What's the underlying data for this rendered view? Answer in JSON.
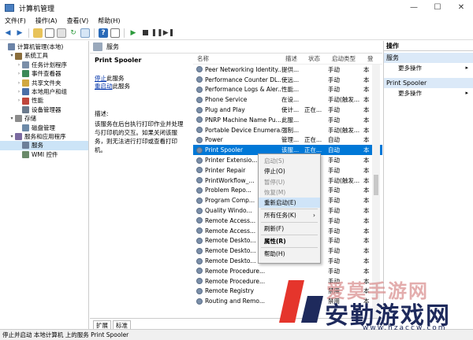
{
  "window": {
    "title": "计算机管理",
    "min": "—",
    "max": "☐",
    "close": "✕"
  },
  "menu": [
    "文件(F)",
    "操作(A)",
    "查看(V)",
    "帮助(H)"
  ],
  "tree": [
    {
      "label": "计算机管理(本地)",
      "level": 0,
      "arrow": ""
    },
    {
      "label": "系统工具",
      "level": 1,
      "arrow": "▾"
    },
    {
      "label": "任务计划程序",
      "level": 2,
      "arrow": "›"
    },
    {
      "label": "事件查看器",
      "level": 2,
      "arrow": "›"
    },
    {
      "label": "共享文件夹",
      "level": 2,
      "arrow": "›"
    },
    {
      "label": "本地用户和组",
      "level": 2,
      "arrow": "›"
    },
    {
      "label": "性能",
      "level": 2,
      "arrow": "›"
    },
    {
      "label": "设备管理器",
      "level": 2,
      "arrow": ""
    },
    {
      "label": "存储",
      "level": 1,
      "arrow": "▾"
    },
    {
      "label": "磁盘管理",
      "level": 2,
      "arrow": ""
    },
    {
      "label": "服务和应用程序",
      "level": 1,
      "arrow": "▾"
    },
    {
      "label": "服务",
      "level": 2,
      "arrow": "",
      "selected": true
    },
    {
      "label": "WMI 控件",
      "level": 2,
      "arrow": ""
    }
  ],
  "center": {
    "header": "服务",
    "service_name": "Print Spooler",
    "stop_link": "停止",
    "stop_suffix": "此服务",
    "restart_link": "重启动",
    "restart_suffix": "此服务",
    "desc_label": "描述:",
    "desc_text": "该服务在后台执行打印作业并处理与打印机的交互。如果关闭该服务，则无法进行打印或查看打印机。"
  },
  "columns": {
    "name": "名称",
    "desc": "描述",
    "status": "状态",
    "startup": "启动类型",
    "logon": "登"
  },
  "services": [
    {
      "name": "Peer Networking Identity...",
      "desc": "提供...",
      "status": "",
      "startup": "手动",
      "logon": "本"
    },
    {
      "name": "Performance Counter DL...",
      "desc": "使远...",
      "status": "",
      "startup": "手动",
      "logon": "本"
    },
    {
      "name": "Performance Logs & Aler...",
      "desc": "性能...",
      "status": "",
      "startup": "手动",
      "logon": "本"
    },
    {
      "name": "Phone Service",
      "desc": "在设...",
      "status": "",
      "startup": "手动(触发...",
      "logon": "本"
    },
    {
      "name": "Plug and Play",
      "desc": "使计...",
      "status": "正在...",
      "startup": "手动",
      "logon": "本"
    },
    {
      "name": "PNRP Machine Name Pu...",
      "desc": "此服...",
      "status": "",
      "startup": "手动",
      "logon": "本"
    },
    {
      "name": "Portable Device Enumera...",
      "desc": "强制...",
      "status": "",
      "startup": "手动(触发...",
      "logon": "本"
    },
    {
      "name": "Power",
      "desc": "管理...",
      "status": "正在...",
      "startup": "自动",
      "logon": "本"
    },
    {
      "name": "Print Spooler",
      "desc": "该服...",
      "status": "正在...",
      "startup": "自动",
      "logon": "本",
      "selected": true
    },
    {
      "name": "Printer Extensio...",
      "desc": "",
      "status": "",
      "startup": "手动",
      "logon": "本"
    },
    {
      "name": "Printer Repair",
      "desc": "",
      "status": "",
      "startup": "手动",
      "logon": "本"
    },
    {
      "name": "PrintWorkflow_...",
      "desc": "",
      "status": "",
      "startup": "手动(触发...",
      "logon": "本"
    },
    {
      "name": "Problem Repo...",
      "desc": "",
      "status": "",
      "startup": "手动",
      "logon": "本"
    },
    {
      "name": "Program Comp...",
      "desc": "",
      "status": "",
      "startup": "手动",
      "logon": "本"
    },
    {
      "name": "Quality Windo...",
      "desc": "",
      "status": "",
      "startup": "手动",
      "logon": "本"
    },
    {
      "name": "Remote Access...",
      "desc": "",
      "status": "",
      "startup": "手动",
      "logon": "本"
    },
    {
      "name": "Remote Access...",
      "desc": "",
      "status": "",
      "startup": "手动",
      "logon": "本"
    },
    {
      "name": "Remote Deskto...",
      "desc": "",
      "status": "",
      "startup": "手动",
      "logon": "本"
    },
    {
      "name": "Remote Deskto...",
      "desc": "",
      "status": "",
      "startup": "手动",
      "logon": "本"
    },
    {
      "name": "Remote Deskto...",
      "desc": "",
      "status": "",
      "startup": "手动",
      "logon": "本"
    },
    {
      "name": "Remote Procedure...",
      "desc": "",
      "status": "",
      "startup": "手动",
      "logon": "本"
    },
    {
      "name": "Remote Procedure...",
      "desc": "",
      "status": "",
      "startup": "手动",
      "logon": "本"
    },
    {
      "name": "Remote Registry",
      "desc": "",
      "status": "",
      "startup": "禁用",
      "logon": "本"
    },
    {
      "name": "Routing and Remo...",
      "desc": "",
      "status": "",
      "startup": "禁用",
      "logon": "本"
    }
  ],
  "context_menu": [
    {
      "label": "启动(S)",
      "state": "disabled"
    },
    {
      "label": "停止(O)",
      "state": ""
    },
    {
      "label": "暂停(U)",
      "state": "disabled"
    },
    {
      "label": "恢复(M)",
      "state": "disabled"
    },
    {
      "label": "重新启动(E)",
      "state": "hover"
    },
    {
      "sep": true
    },
    {
      "label": "所有任务(K)",
      "state": "",
      "submenu": "›"
    },
    {
      "sep": true
    },
    {
      "label": "刷新(F)",
      "state": ""
    },
    {
      "sep": true
    },
    {
      "label": "属性(R)",
      "state": "bold"
    },
    {
      "sep": true
    },
    {
      "label": "帮助(H)",
      "state": ""
    }
  ],
  "actions": {
    "title": "操作",
    "sections": [
      {
        "label": "服务",
        "item": "更多操作"
      },
      {
        "label": "Print Spooler",
        "item": "更多操作"
      }
    ],
    "chev": "▸"
  },
  "tabs": [
    "扩展",
    "标准"
  ],
  "status": "停止并启动 本地计算机 上的服务 Print Spooler",
  "watermark": {
    "line1": "爱莫手游网",
    "line2": "安勤游戏网",
    "url": "www.hzaccw.com"
  },
  "colors": {
    "selected": "#0078d7",
    "hover": "#cfe4f8",
    "link": "#0033aa"
  }
}
